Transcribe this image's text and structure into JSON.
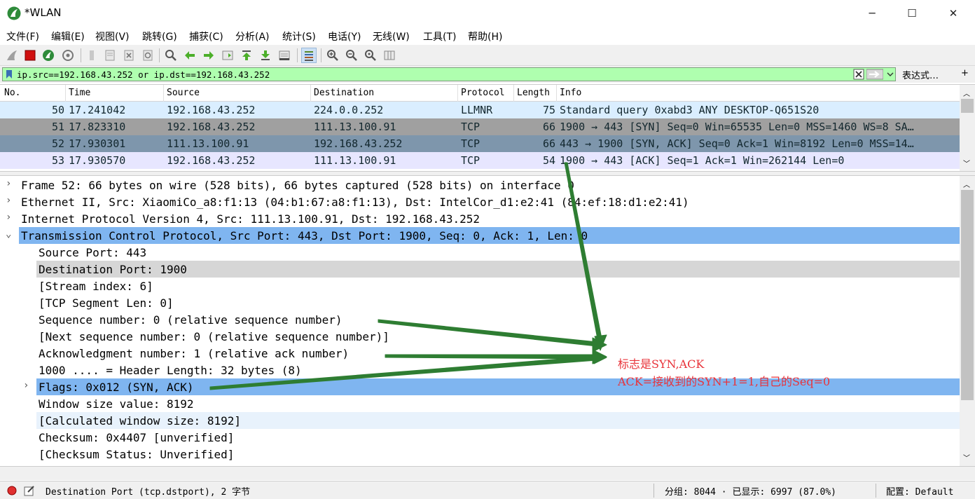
{
  "window": {
    "title": "*WLAN",
    "minimize_glyph": "─",
    "maximize_glyph": "☐",
    "close_glyph": "✕"
  },
  "menu": [
    "文件(F)",
    "编辑(E)",
    "视图(V)",
    "跳转(G)",
    "捕获(C)",
    "分析(A)",
    "统计(S)",
    "电话(Y)",
    "无线(W)",
    "工具(T)",
    "帮助(H)"
  ],
  "toolbar_icons": [
    "shark-fin-start-icon",
    "stop-capture-icon",
    "restart-capture-icon",
    "capture-options-icon",
    "open-file-icon",
    "save-file-icon",
    "close-file-icon",
    "reload-file-icon",
    "find-packet-icon",
    "go-back-icon",
    "go-forward-icon",
    "go-to-packet-icon",
    "first-packet-icon",
    "last-packet-icon",
    "auto-scroll-icon",
    "colorize-icon",
    "zoom-in-icon",
    "zoom-out-icon",
    "normal-size-icon",
    "resize-columns-icon"
  ],
  "filter": {
    "value": "ip.src==192.168.43.252 or ip.dst==192.168.43.252",
    "expression_label": "表达式…",
    "add_label": "+"
  },
  "packet_list": {
    "columns": [
      "No.",
      "Time",
      "Source",
      "Destination",
      "Protocol",
      "Length",
      "Info"
    ],
    "rows": [
      {
        "no": "50",
        "time": "17.241042",
        "source": "192.168.43.252",
        "destination": "224.0.0.252",
        "protocol": "LLMNR",
        "length": "75",
        "info": "Standard query 0xabd3 ANY DESKTOP-Q651S20",
        "bg": "#daeeff",
        "fg": "#12272e"
      },
      {
        "no": "51",
        "time": "17.823310",
        "source": "192.168.43.252",
        "destination": "111.13.100.91",
        "protocol": "TCP",
        "length": "66",
        "info": "1900 → 443 [SYN] Seq=0 Win=65535 Len=0 MSS=1460 WS=8 SA…",
        "bg": "#a0a0a0",
        "fg": "#12272e"
      },
      {
        "no": "52",
        "time": "17.930301",
        "source": "111.13.100.91",
        "destination": "192.168.43.252",
        "protocol": "TCP",
        "length": "66",
        "info": "443 → 1900 [SYN, ACK] Seq=0 Ack=1 Win=8192 Len=0 MSS=14…",
        "bg": "#7e96ac",
        "fg": "#12272e"
      },
      {
        "no": "53",
        "time": "17.930570",
        "source": "192.168.43.252",
        "destination": "111.13.100.91",
        "protocol": "TCP",
        "length": "54",
        "info": "1900 → 443 [ACK] Seq=1 Ack=1 Win=262144 Len=0",
        "bg": "#e7e6ff",
        "fg": "#12272e"
      }
    ]
  },
  "details": [
    {
      "text": "Frame 52: 66 bytes on wire (528 bits), 66 bytes captured (528 bits) on interface 0",
      "indent": 0,
      "arrow": "›",
      "bg": "#ffffff"
    },
    {
      "text": "Ethernet II, Src: XiaomiCo_a8:f1:13 (04:b1:67:a8:f1:13), Dst: IntelCor_d1:e2:41 (84:ef:18:d1:e2:41)",
      "indent": 0,
      "arrow": "›",
      "bg": "#ffffff"
    },
    {
      "text": "Internet Protocol Version 4, Src: 111.13.100.91, Dst: 192.168.43.252",
      "indent": 0,
      "arrow": "›",
      "bg": "#ffffff"
    },
    {
      "text": "Transmission Control Protocol, Src Port: 443, Dst Port: 1900, Seq: 0, Ack: 1, Len: 0",
      "indent": 0,
      "arrow": "⌄",
      "bg": "#7fb5f0"
    },
    {
      "text": "Source Port: 443",
      "indent": 1,
      "arrow": "",
      "bg": "#ffffff"
    },
    {
      "text": "Destination Port: 1900",
      "indent": 1,
      "arrow": "",
      "bg": "#d6d6d6"
    },
    {
      "text": "[Stream index: 6]",
      "indent": 1,
      "arrow": "",
      "bg": "#ffffff"
    },
    {
      "text": "[TCP Segment Len: 0]",
      "indent": 1,
      "arrow": "",
      "bg": "#ffffff"
    },
    {
      "text": "Sequence number: 0    (relative sequence number)",
      "indent": 1,
      "arrow": "",
      "bg": "#ffffff"
    },
    {
      "text": "[Next sequence number: 0    (relative sequence number)]",
      "indent": 1,
      "arrow": "",
      "bg": "#ffffff"
    },
    {
      "text": "Acknowledgment number: 1    (relative ack number)",
      "indent": 1,
      "arrow": "",
      "bg": "#ffffff"
    },
    {
      "text": "1000 .... = Header Length: 32 bytes (8)",
      "indent": 1,
      "arrow": "",
      "bg": "#ffffff"
    },
    {
      "text": "Flags: 0x012 (SYN, ACK)",
      "indent": 1,
      "arrow": "›",
      "bg": "#7fb5f0"
    },
    {
      "text": "Window size value: 8192",
      "indent": 1,
      "arrow": "",
      "bg": "#ffffff"
    },
    {
      "text": "[Calculated window size: 8192]",
      "indent": 1,
      "arrow": "",
      "bg": "#e8f2fc"
    },
    {
      "text": "Checksum: 0x4407 [unverified]",
      "indent": 1,
      "arrow": "",
      "bg": "#ffffff"
    },
    {
      "text": "[Checksum Status: Unverified]",
      "indent": 1,
      "arrow": "",
      "bg": "#ffffff"
    }
  ],
  "annotation": {
    "line1": "标志是SYN,ACK",
    "line2": "ACK=接收到的SYN+1=1,自己的Seq=0",
    "color": "#e8333a",
    "arrow_color": "#2e7d32"
  },
  "status": {
    "field_desc": "Destination Port (tcp.dstport), 2 字节",
    "groups": "分组: 8044 · 已显示: 6997 (87.0%)",
    "profile": "配置: Default"
  }
}
